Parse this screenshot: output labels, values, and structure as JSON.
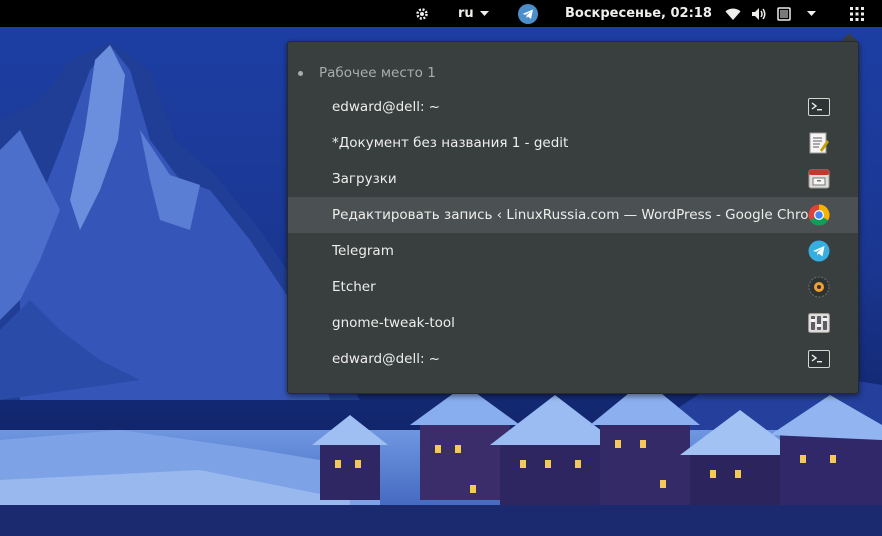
{
  "panel": {
    "language": "ru",
    "clock": "Воскресенье, 02:18",
    "icons": [
      "settings-gear-icon",
      "telegram-tray-icon",
      "wifi-icon",
      "volume-icon",
      "battery-icon",
      "system-menu-caret-icon",
      "activities-grid-icon"
    ]
  },
  "menu": {
    "workspace_title": "Рабочее место 1",
    "windows": [
      {
        "title": "edward@dell: ~",
        "icon": "terminal-icon"
      },
      {
        "title": "*Документ без названия 1 - gedit",
        "icon": "gedit-icon"
      },
      {
        "title": "Загрузки",
        "icon": "files-icon"
      },
      {
        "title": "Редактировать запись ‹ LinuxRussia.com — WordPress - Google Chrome",
        "icon": "chrome-icon",
        "highlighted": true
      },
      {
        "title": "Telegram",
        "icon": "telegram-icon"
      },
      {
        "title": "Etcher",
        "icon": "etcher-icon"
      },
      {
        "title": "gnome-tweak-tool",
        "icon": "tweak-tool-icon"
      },
      {
        "title": "edward@dell: ~",
        "icon": "terminal-icon"
      }
    ]
  },
  "colors": {
    "panel_bg": "#000000",
    "menu_bg": "#393f3f",
    "highlight_bg": "#4b5152",
    "text": "#eeeeec",
    "muted_text": "#a9acac"
  }
}
